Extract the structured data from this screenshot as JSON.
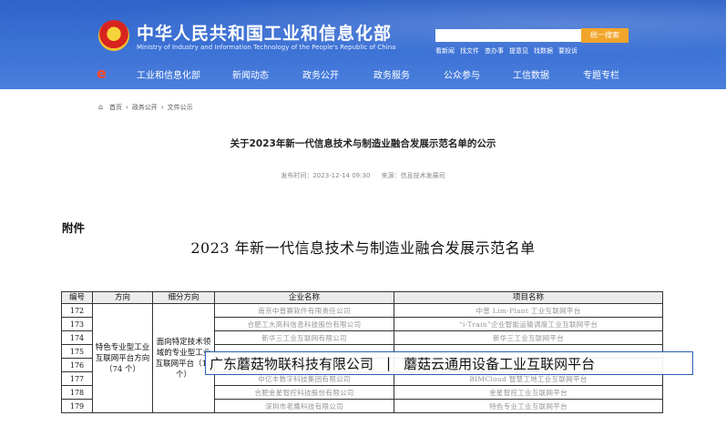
{
  "header": {
    "title_cn": "中华人民共和国工业和信息化部",
    "title_en": "Ministry of Industry and Information Technology of the People's Republic of China",
    "search_button": "统一搜索",
    "quick_links": [
      "看新闻",
      "找文件",
      "查办事",
      "提意见",
      "找数据",
      "要投诉"
    ],
    "nav": [
      "工业和信息化部",
      "新闻动态",
      "政务公开",
      "政务服务",
      "公众参与",
      "工信数据",
      "专题专栏"
    ],
    "colors": {
      "header_blue": "#3d72d6",
      "search_orange": "#f2a52a",
      "logo_red": "#ff4a2a"
    }
  },
  "breadcrumb": [
    "首页",
    "政务公开",
    "文件公示"
  ],
  "article": {
    "title": "关于2023年新一代信息技术与制造业融合发展示范名单的公示",
    "publish_time": "发布时间：2023-12-14 09:30",
    "source": "来源：信息技术发展司"
  },
  "attachment": {
    "label": "附件",
    "doc_title": "2023 年新一代信息技术与制造业融合发展示范名单"
  },
  "table": {
    "headers": [
      "编号",
      "方向",
      "细分方向",
      "企业名称",
      "项目名称"
    ],
    "direction": "特色专业型工业互联网平台方向（74 个）",
    "sub_direction": "面向特定技术领域的专业型工业互联网平台（13 个）",
    "rows": [
      {
        "num": "172",
        "company": "南京中普赛软件有限责任公司",
        "project": "中普 Lim-Plant 工业互联网平台"
      },
      {
        "num": "173",
        "company": "合肥工大高科信息科技股份有限公司",
        "project": "“i-Train”企业智能运输调度工业互联网平台"
      },
      {
        "num": "174",
        "company": "新华三工业互联网有限公司",
        "project": "新华三工业互联网平台"
      },
      {
        "num": "175",
        "company": "",
        "project": ""
      },
      {
        "num": "176",
        "company": "",
        "project": ""
      },
      {
        "num": "177",
        "company": "中亿丰数字科技集团有限公司",
        "project": "BIMCloud 智慧工地工业互联网平台"
      },
      {
        "num": "178",
        "company": "合肥金星智控科技股份有限公司",
        "project": "金星智控工业互联网平台"
      },
      {
        "num": "179",
        "company": "深圳市老鹰科技有限公司",
        "project": "特色专业工业互联网平台"
      }
    ]
  },
  "overlay": {
    "company": "广东蘑菇物联科技有限公司",
    "separator": "|",
    "project": "蘑菇云通用设备工业互联网平台"
  }
}
